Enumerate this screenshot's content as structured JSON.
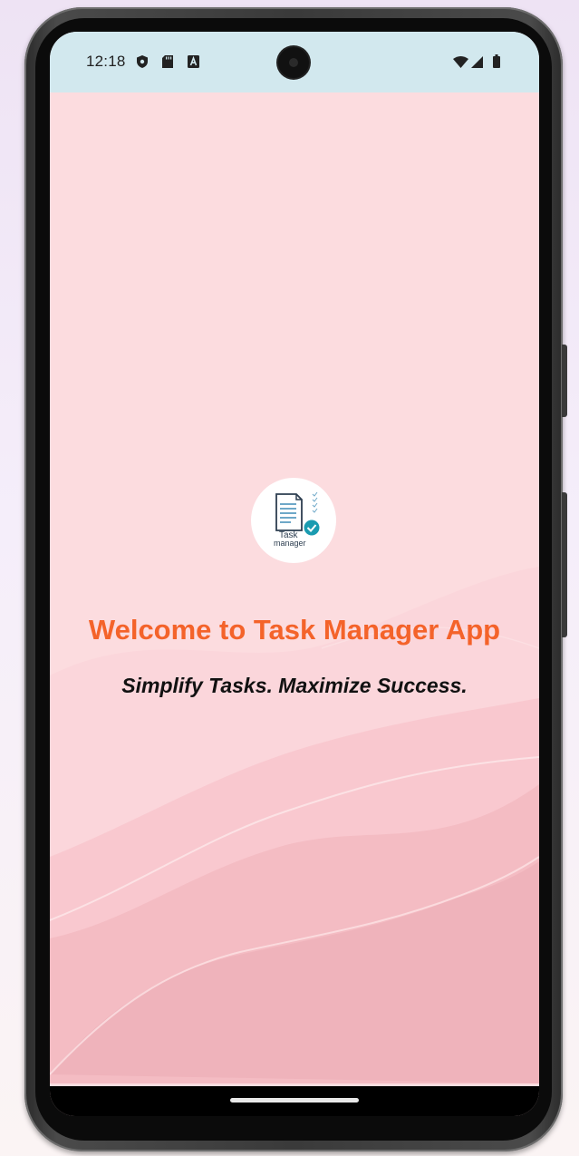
{
  "status_bar": {
    "time": "12:18",
    "left_icons": [
      "shield-icon",
      "sd-card-icon",
      "a-badge-icon"
    ],
    "right_icons": [
      "wifi-icon",
      "signal-icon",
      "battery-icon"
    ],
    "background": "#d2e8ee"
  },
  "logo": {
    "line1": "Task",
    "line2": "manager",
    "check_color": "#1a9bb0"
  },
  "splash": {
    "title": "Welcome to Task Manager App",
    "subtitle": "Simplify Tasks. Maximize Success.",
    "title_color": "#f4632a",
    "background": "#fcdcdf"
  }
}
